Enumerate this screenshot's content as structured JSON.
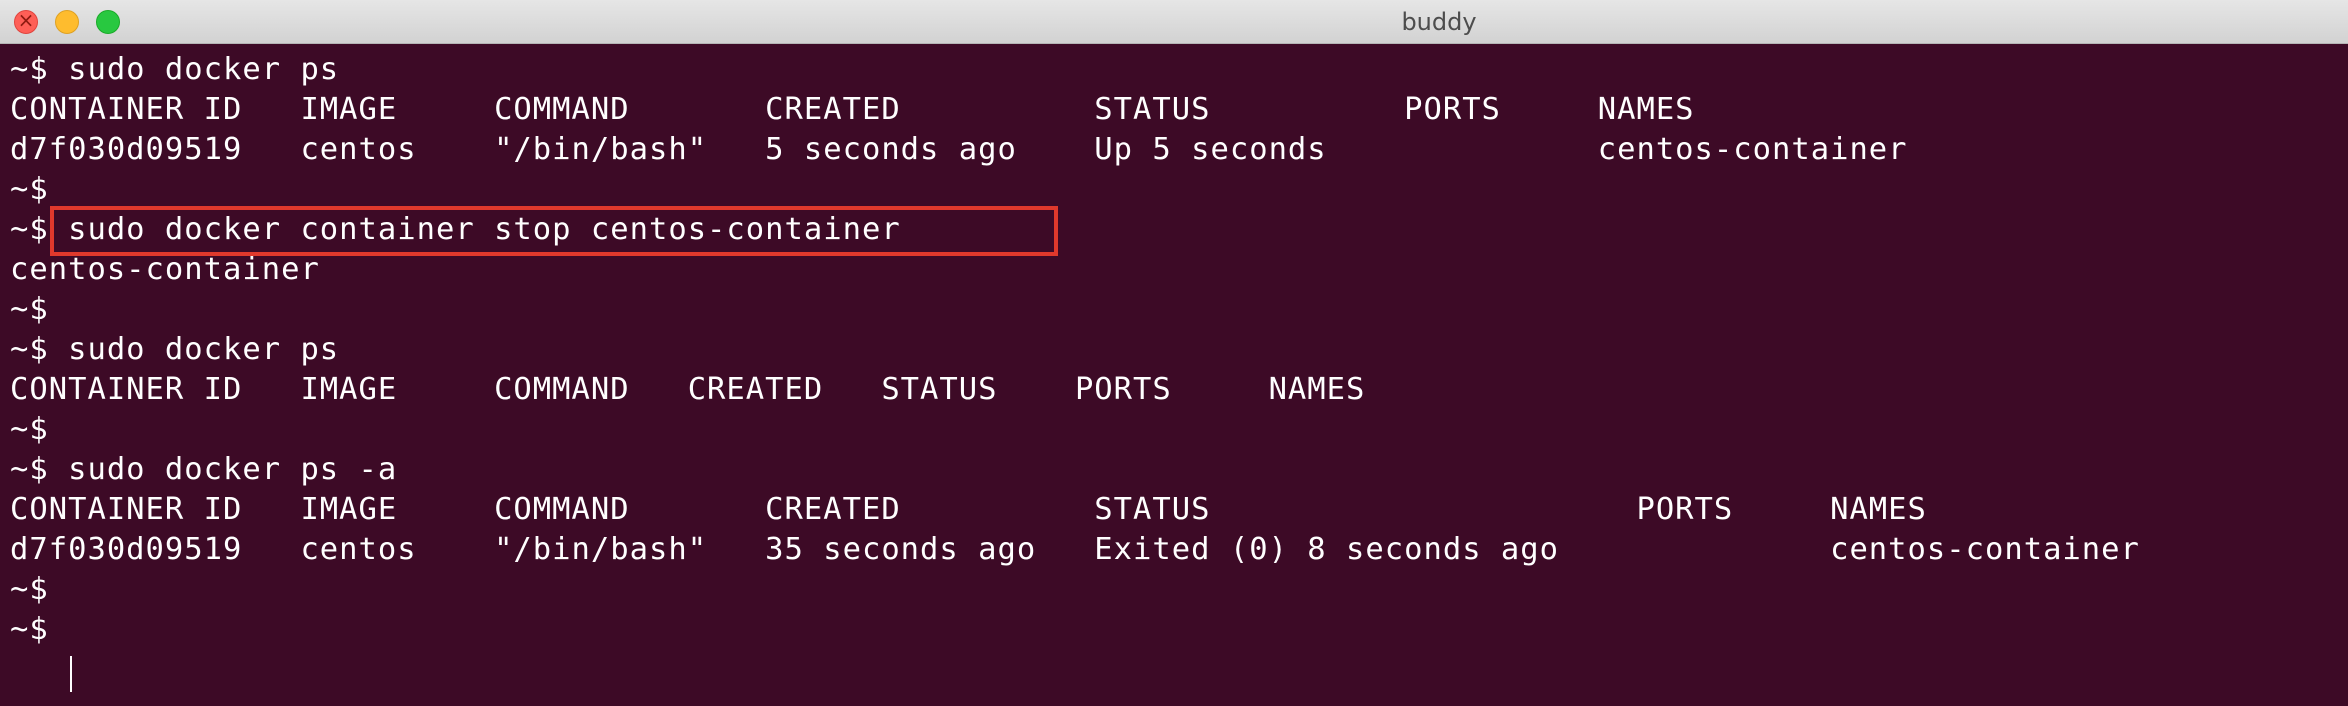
{
  "window": {
    "title": "buddy"
  },
  "terminal": {
    "lines": [
      "~$ sudo docker ps",
      "CONTAINER ID   IMAGE     COMMAND       CREATED          STATUS          PORTS     NAMES",
      "d7f030d09519   centos    \"/bin/bash\"   5 seconds ago    Up 5 seconds              centos-container",
      "~$",
      "~$ sudo docker container stop centos-container",
      "centos-container",
      "~$",
      "~$ sudo docker ps",
      "CONTAINER ID   IMAGE     COMMAND   CREATED   STATUS    PORTS     NAMES",
      "~$",
      "~$ sudo docker ps -a",
      "CONTAINER ID   IMAGE     COMMAND       CREATED          STATUS                      PORTS     NAMES",
      "d7f030d09519   centos    \"/bin/bash\"   35 seconds ago   Exited (0) 8 seconds ago              centos-container",
      "~$",
      "~$ "
    ],
    "highlighted_command": "sudo docker container stop centos-container"
  },
  "colors": {
    "background": "#3d0a26",
    "text": "#ffffff",
    "highlight_border": "#e0392c"
  },
  "icons": [
    "close-icon",
    "minimize-icon",
    "maximize-icon"
  ]
}
